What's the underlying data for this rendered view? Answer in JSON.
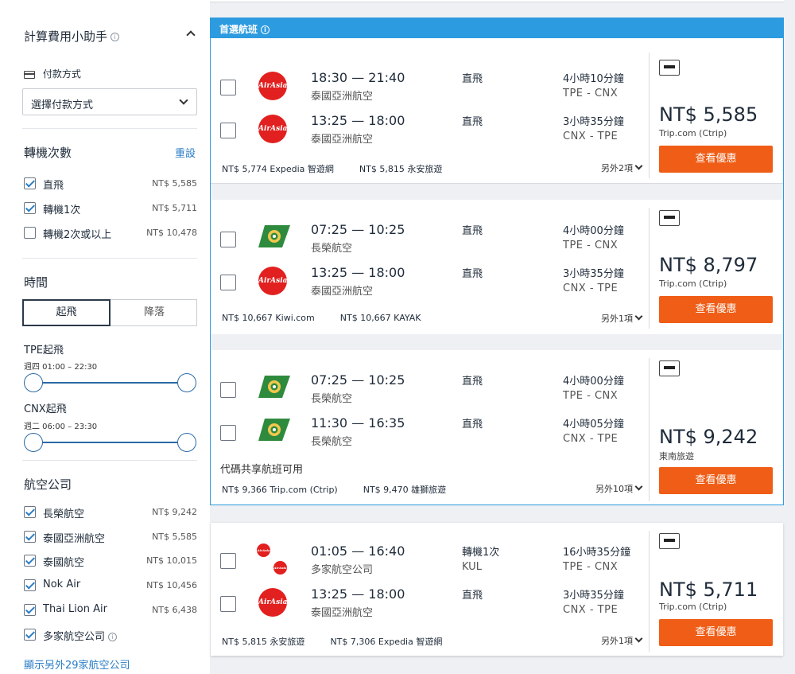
{
  "sidebar": {
    "helper_title": "計算費用小助手",
    "payment": {
      "label": "付款方式",
      "select_value": "選擇付款方式"
    },
    "stops": {
      "title": "轉機次數",
      "reset": "重設",
      "items": [
        {
          "label": "直飛",
          "price": "NT$ 5,585",
          "checked": true
        },
        {
          "label": "轉機1次",
          "price": "NT$ 5,711",
          "checked": true
        },
        {
          "label": "轉機2次或以上",
          "price": "NT$ 10,478",
          "checked": false
        }
      ]
    },
    "time": {
      "title": "時間",
      "tabs": [
        "起飛",
        "降落"
      ],
      "sliders": [
        {
          "title": "TPE起飛",
          "range": "週四 01:00 – 22:30"
        },
        {
          "title": "CNX起飛",
          "range": "週二 06:00 – 23:30"
        }
      ]
    },
    "airlines": {
      "title": "航空公司",
      "items": [
        {
          "label": "長榮航空",
          "price": "NT$ 9,242"
        },
        {
          "label": "泰國亞洲航空",
          "price": "NT$ 5,585"
        },
        {
          "label": "泰國航空",
          "price": "NT$ 10,015"
        },
        {
          "label": "Nok Air",
          "price": "NT$ 10,456"
        },
        {
          "label": "Thai Lion Air",
          "price": "NT$ 6,438"
        },
        {
          "label": "多家航空公司",
          "price": ""
        }
      ],
      "show_more": "顯示另外29家航空公司"
    }
  },
  "results": {
    "preferred_header": "首選航班",
    "cards": [
      {
        "flights": [
          {
            "logo": "airasia-logo",
            "logo_text": "AirAsia",
            "times": "18:30 — 21:40",
            "airline": "泰國亞洲航空",
            "stops": "直飛",
            "via": "",
            "duration": "4小時10分鐘",
            "route": "TPE - CNX"
          },
          {
            "logo": "airasia-logo",
            "logo_text": "AirAsia",
            "times": "13:25 — 18:00",
            "airline": "泰國亞洲航空",
            "stops": "直飛",
            "via": "",
            "duration": "3小時35分鐘",
            "route": "CNX - TPE"
          }
        ],
        "other_prices": [
          "NT$ 5,774 Expedia 智遊網",
          "NT$ 5,815 永安旅遊"
        ],
        "more": "另外2項",
        "price": "NT$ 5,585",
        "vendor": "Trip.com (Ctrip)",
        "button": "查看優惠"
      },
      {
        "flights": [
          {
            "logo": "eva-logo",
            "times": "07:25 — 10:25",
            "airline": "長榮航空",
            "stops": "直飛",
            "via": "",
            "duration": "4小時00分鐘",
            "route": "TPE - CNX"
          },
          {
            "logo": "airasia-logo",
            "logo_text": "AirAsia",
            "times": "13:25 — 18:00",
            "airline": "泰國亞洲航空",
            "stops": "直飛",
            "via": "",
            "duration": "3小時35分鐘",
            "route": "CNX - TPE"
          }
        ],
        "other_prices": [
          "NT$ 10,667 Kiwi.com",
          "NT$ 10,667 KAYAK"
        ],
        "more": "另外1項",
        "price": "NT$ 8,797",
        "vendor": "Trip.com (Ctrip)",
        "button": "查看優惠"
      },
      {
        "flights": [
          {
            "logo": "eva-logo",
            "times": "07:25 — 10:25",
            "airline": "長榮航空",
            "stops": "直飛",
            "via": "",
            "duration": "4小時00分鐘",
            "route": "TPE - CNX"
          },
          {
            "logo": "eva-logo",
            "times": "11:30 — 16:35",
            "airline": "長榮航空",
            "stops": "直飛",
            "via": "",
            "duration": "4小時05分鐘",
            "route": "CNX - TPE"
          }
        ],
        "codeshare": "代碼共享航班可用",
        "other_prices": [
          "NT$ 9,366 Trip.com (Ctrip)",
          "NT$ 9,470 雄獅旅遊"
        ],
        "more": "另外10項",
        "price": "NT$ 9,242",
        "vendor": "東南旅遊",
        "button": "查看優惠"
      },
      {
        "flights": [
          {
            "logo": "multi-logo",
            "logo_text": "AirAsia",
            "times": "01:05 — 16:40",
            "airline": "多家航空公司",
            "stops": "轉機1次",
            "via": "KUL",
            "duration": "16小時35分鐘",
            "route": "TPE - CNX"
          },
          {
            "logo": "airasia-logo",
            "logo_text": "AirAsia",
            "times": "13:25 — 18:00",
            "airline": "泰國亞洲航空",
            "stops": "直飛",
            "via": "",
            "duration": "3小時35分鐘",
            "route": "CNX - TPE"
          }
        ],
        "other_prices": [
          "NT$ 5,815 永安旅遊",
          "NT$ 7,306 Expedia 智遊網"
        ],
        "more": "另外1項",
        "price": "NT$ 5,711",
        "vendor": "Trip.com (Ctrip)",
        "button": "查看優惠"
      }
    ]
  },
  "colors": {
    "accent": "#2d9be0",
    "button": "#ef5d16",
    "link": "#2a7dc5",
    "airasia": "#e1201f",
    "eva": "#2e8b3e"
  }
}
